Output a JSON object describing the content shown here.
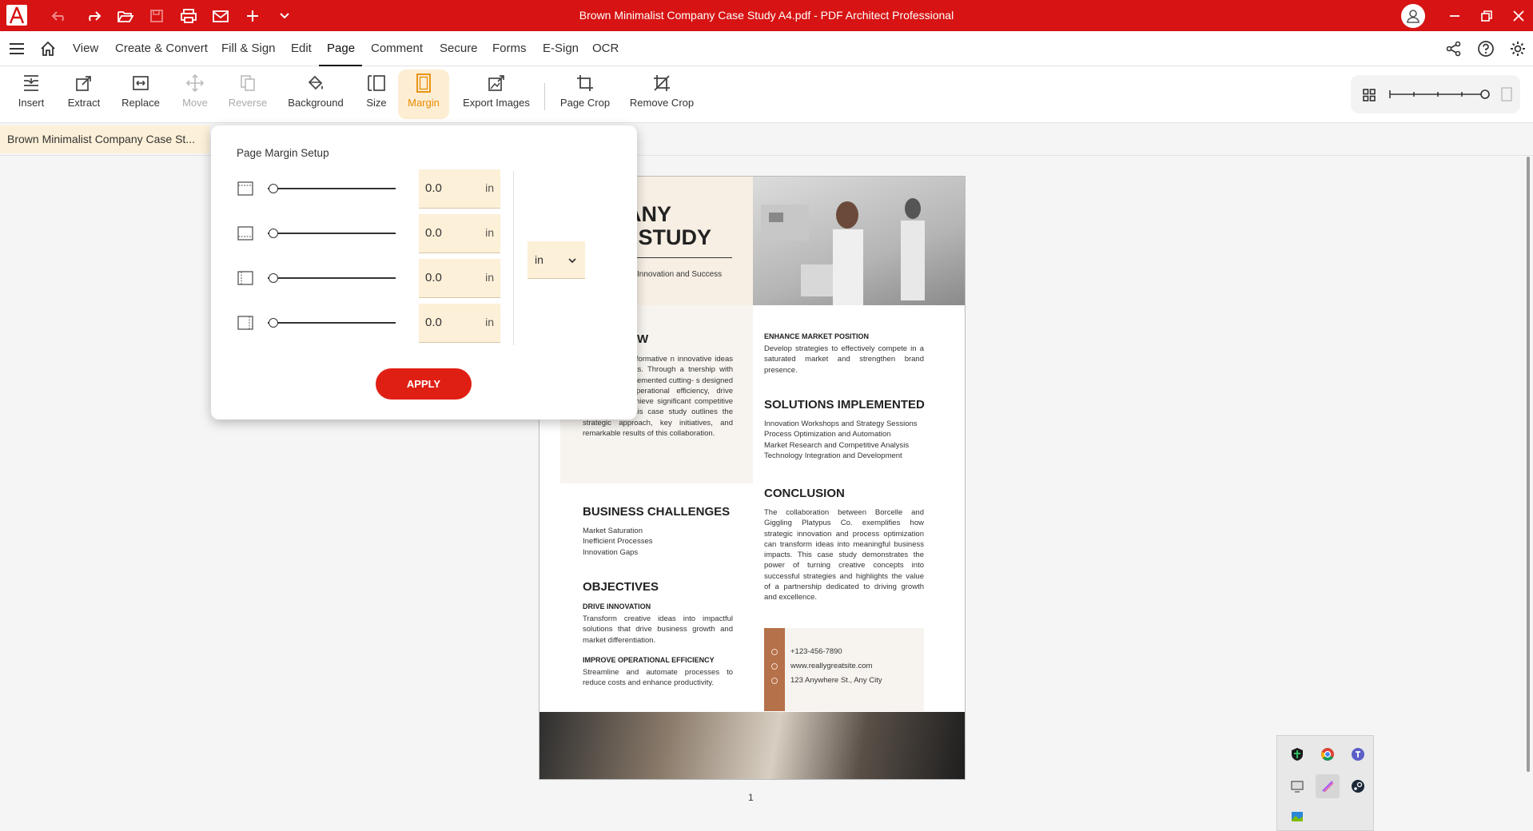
{
  "title_bar": {
    "title": "Brown Minimalist Company Case Study A4.pdf  -  PDF Architect Professional",
    "quick_access": [
      "undo-icon",
      "redo-icon",
      "open-icon",
      "save-icon",
      "print-icon",
      "mail-icon",
      "add-icon",
      "more-icon"
    ]
  },
  "menu": {
    "items": [
      "View",
      "Create & Convert",
      "Fill & Sign",
      "Edit",
      "Page",
      "Comment",
      "Secure",
      "Forms",
      "E-Sign",
      "OCR"
    ],
    "active": "Page"
  },
  "ribbon": {
    "buttons": [
      {
        "label": "Insert",
        "state": "normal"
      },
      {
        "label": "Extract",
        "state": "normal"
      },
      {
        "label": "Replace",
        "state": "normal"
      },
      {
        "label": "Move",
        "state": "disabled"
      },
      {
        "label": "Reverse",
        "state": "disabled"
      },
      {
        "label": "Background",
        "state": "normal"
      },
      {
        "label": "Size",
        "state": "normal"
      },
      {
        "label": "Margin",
        "state": "active"
      },
      {
        "label": "Export Images",
        "state": "normal"
      },
      {
        "label": "Page Crop",
        "state": "normal"
      },
      {
        "label": "Remove Crop",
        "state": "normal"
      }
    ]
  },
  "document_tab": {
    "label": "Brown Minimalist Company Case St..."
  },
  "margin_dialog": {
    "title": "Page Margin Setup",
    "margins": [
      {
        "side": "top",
        "value": "0.0",
        "unit": "in"
      },
      {
        "side": "bottom",
        "value": "0.0",
        "unit": "in"
      },
      {
        "side": "left",
        "value": "0.0",
        "unit": "in"
      },
      {
        "side": "right",
        "value": "0.0",
        "unit": "in"
      }
    ],
    "unit_select": "in",
    "apply_label": "APPLY"
  },
  "pdf_page": {
    "title_line1": "PANY",
    "title_line2": "E STUDY",
    "tagline": "Innovation and Success",
    "overview_head": "W",
    "overview_text": "rked on a transformative n innovative ideas into ess impacts. Through a tnership with Giggling ey implemented cutting- s designed to enhance operational efficiency, drive growth, and achieve significant competitive advantages. This case study outlines the strategic approach, key initiatives, and remarkable results of this collaboration.",
    "enhance_head": "ENHANCE MARKET POSITION",
    "enhance_text": "Develop strategies to effectively compete in a saturated market and strengthen brand presence.",
    "solutions_head": "SOLUTIONS IMPLEMENTED",
    "solutions_items": [
      "Innovation Workshops and Strategy Sessions",
      "Process Optimization and Automation",
      "Market Research and Competitive Analysis",
      "Technology Integration and Development"
    ],
    "challenges_head": "BUSINESS CHALLENGES",
    "challenges_items": [
      "Market Saturation",
      "Inefficient Processes",
      "Innovation Gaps"
    ],
    "conclusion_head": "CONCLUSION",
    "conclusion_text": "The collaboration between Borcelle and Giggling Platypus Co. exemplifies how strategic innovation and process optimization can transform ideas into meaningful business impacts. This case study demonstrates the power of turning creative concepts into successful strategies and highlights the value of a partnership dedicated to driving growth and excellence.",
    "objectives_head": "OBJECTIVES",
    "drive_head": "DRIVE INNOVATION",
    "drive_text": "Transform creative ideas into impactful solutions that drive business growth and market differentiation.",
    "improve_head": "IMPROVE OPERATIONAL EFFICIENCY",
    "improve_text": "Streamline and automate processes to reduce costs and enhance productivity.",
    "contact": [
      "+123-456-7890",
      "www.reallygreatsite.com",
      "123 Anywhere St., Any City"
    ],
    "page_number": "1"
  },
  "colors": {
    "brand_red": "#d71313",
    "accent_orange": "#e88a00",
    "active_bg": "#fdeed3",
    "apply_red": "#e01f14",
    "page_brown": "#b5714a"
  }
}
